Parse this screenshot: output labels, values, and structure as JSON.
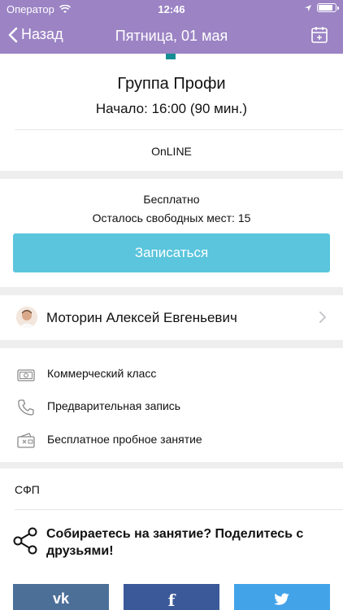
{
  "status": {
    "carrier": "Оператор",
    "time": "12:46"
  },
  "nav": {
    "back": "Назад",
    "title": "Пятница, 01 мая"
  },
  "event": {
    "title": "Группа Профи",
    "start": "Начало: 16:00 (90 мин.)",
    "location": "OnLINE",
    "price": "Бесплатно",
    "seats": "Осталось свободных мест: 15",
    "signup": "Записаться"
  },
  "trainer": {
    "name": "Моторин Алексей Евгеньевич"
  },
  "features": [
    {
      "label": "Коммерческий класс",
      "icon": "money-icon"
    },
    {
      "label": "Предварительная запись",
      "icon": "phone-icon"
    },
    {
      "label": "Бесплатное пробное занятие",
      "icon": "wallet-icon"
    }
  ],
  "program": "СФП",
  "share": {
    "text": "Собираетесь на занятие? Поделитесь с друзьями!",
    "networks": [
      {
        "label": "vk",
        "icon": "vk-icon",
        "color": "#4c6f98"
      },
      {
        "label": "f",
        "icon": "facebook-icon",
        "color": "#3b5998"
      },
      {
        "label": "twitter",
        "icon": "twitter-icon",
        "color": "#43a3e9"
      }
    ]
  },
  "colors": {
    "header": "#9b83c4",
    "accent": "#5ac5dd",
    "teal": "#138e93"
  }
}
